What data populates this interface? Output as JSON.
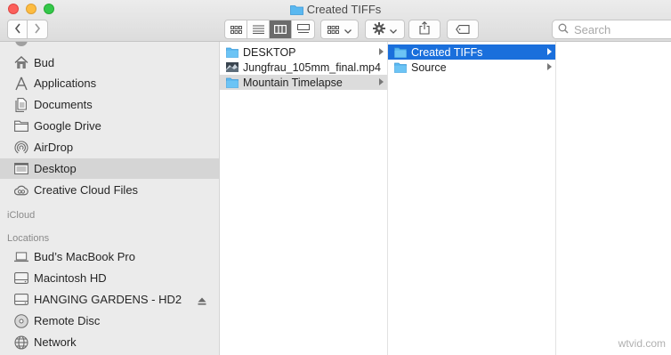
{
  "window": {
    "title": "Created TIFFs"
  },
  "toolbar": {
    "back_icon": "chevron-left-icon",
    "forward_icon": "chevron-right-icon",
    "view_modes": [
      "icon-view",
      "list-view",
      "column-view",
      "gallery-view"
    ],
    "active_view": "column-view",
    "group_icon": "group-icon",
    "action_icon": "gear-icon",
    "share_icon": "share-icon",
    "tag_icon": "tag-icon",
    "search_placeholder": "Search"
  },
  "sidebar": {
    "favorites": [
      {
        "label": "Bud",
        "icon": "home-icon"
      },
      {
        "label": "Applications",
        "icon": "applications-icon"
      },
      {
        "label": "Documents",
        "icon": "documents-icon"
      },
      {
        "label": "Google Drive",
        "icon": "folder-icon"
      },
      {
        "label": "AirDrop",
        "icon": "airdrop-icon"
      },
      {
        "label": "Desktop",
        "icon": "desktop-icon",
        "selected": true
      },
      {
        "label": "Creative Cloud Files",
        "icon": "creative-cloud-icon"
      }
    ],
    "icloud_heading": "iCloud",
    "locations_heading": "Locations",
    "locations": [
      {
        "label": "Bud’s MacBook Pro",
        "icon": "laptop-icon"
      },
      {
        "label": "Macintosh HD",
        "icon": "drive-icon"
      },
      {
        "label": "HANGING GARDENS - HD2",
        "icon": "drive-icon",
        "eject": true
      },
      {
        "label": "Remote Disc",
        "icon": "disc-icon"
      },
      {
        "label": "Network",
        "icon": "network-icon"
      }
    ]
  },
  "columns": [
    {
      "items": [
        {
          "label": "DESKTOP",
          "icon": "folder-icon",
          "has_children": true
        },
        {
          "label": "Jungfrau_105mm_final.mp4",
          "icon": "video-thumbnail-icon",
          "has_children": false
        },
        {
          "label": "Mountain Timelapse",
          "icon": "folder-icon",
          "has_children": true,
          "selected": "inactive"
        }
      ]
    },
    {
      "items": [
        {
          "label": "Created TIFFs",
          "icon": "folder-icon",
          "has_children": true,
          "selected": "active"
        },
        {
          "label": "Source",
          "icon": "folder-icon",
          "has_children": true
        }
      ]
    },
    {
      "items": []
    }
  ],
  "colors": {
    "selection_blue": "#1a6fdc",
    "folder_blue": "#5ab8f0",
    "sidebar_bg": "#ebebeb"
  },
  "watermark": "wtvid.com"
}
